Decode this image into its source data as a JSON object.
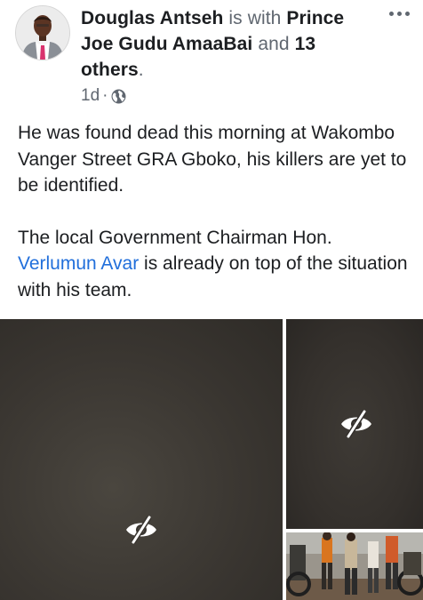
{
  "post": {
    "author": "Douglas Antseh",
    "with_word": "is with",
    "tagged": "Prince Joe Gudu AmaaBai",
    "and_word": "and",
    "others": "13 others",
    "period": ".",
    "time": "1d",
    "separator": "·",
    "privacy_icon": "globe-icon",
    "menu_icon": "more-horizontal-icon",
    "text": {
      "paragraph1": "He was found dead this morning at Wakombo Vanger Street GRA Gboko, his killers are yet to be identified.",
      "paragraph2_before": "The local Government Chairman Hon. ",
      "mention": "Verlumun Avar",
      "paragraph2_after": " is already on top of the situation with his team."
    }
  },
  "photos": {
    "hidden_icon": "eye-slash-icon",
    "count_visible": 3
  },
  "colors": {
    "link": "#216fdb",
    "muted": "#606770",
    "text": "#1c1e21"
  }
}
